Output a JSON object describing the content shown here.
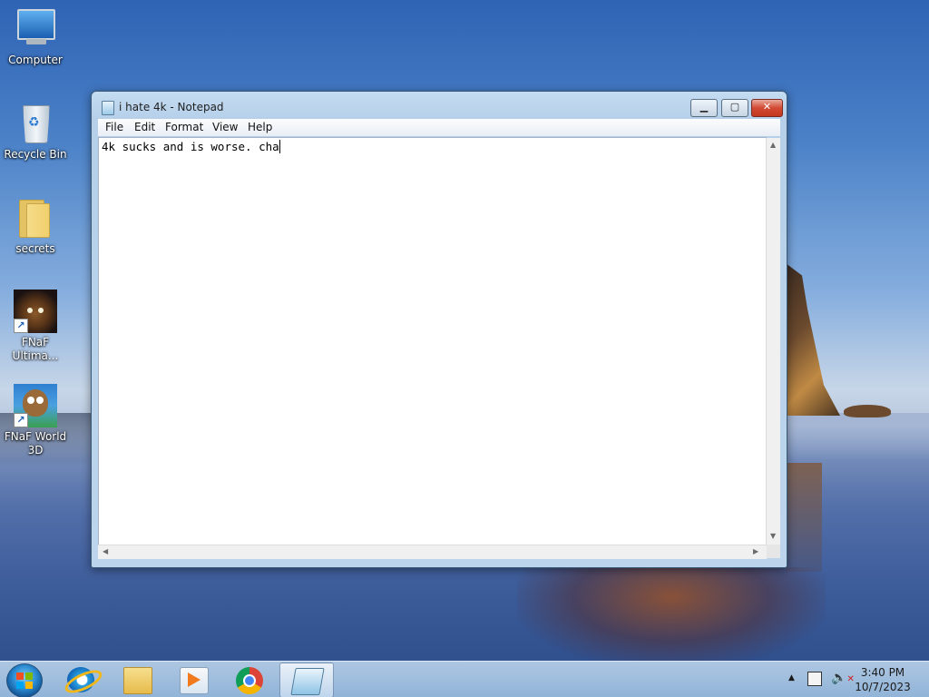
{
  "desktop": {
    "icons": [
      {
        "label": "Computer",
        "icon": "computer-icon"
      },
      {
        "label": "Recycle Bin",
        "icon": "recycle-bin-icon"
      },
      {
        "label": "secrets",
        "icon": "folder-icon"
      },
      {
        "label": "FNaF Ultima...",
        "label_line1": "FNaF",
        "label_line2": "Ultima...",
        "icon": "fnaf-game-icon"
      },
      {
        "label": "FNaF World 3D",
        "label_line1": "FNaF World",
        "label_line2": "3D",
        "icon": "fnaf-world-game-icon"
      }
    ]
  },
  "window": {
    "title": "i hate 4k - Notepad",
    "controls": {
      "minimize": "▁",
      "maximize": "▢",
      "close": "✕"
    },
    "menu": [
      "File",
      "Edit",
      "Format",
      "View",
      "Help"
    ],
    "content": "4k sucks and is worse. cha"
  },
  "taskbar": {
    "pinned": [
      {
        "name": "Internet Explorer",
        "icon": "internet-explorer-icon"
      },
      {
        "name": "Windows Explorer",
        "icon": "file-explorer-icon"
      },
      {
        "name": "Windows Media Player",
        "icon": "media-player-icon"
      },
      {
        "name": "Google Chrome",
        "icon": "chrome-icon"
      },
      {
        "name": "Notepad",
        "icon": "notepad-icon",
        "active": true
      }
    ],
    "tray": {
      "time": "3:40 PM",
      "date": "10/7/2023",
      "show_hidden": "▲",
      "network_icon": "network-icon",
      "volume_icon": "volume-muted-icon"
    }
  },
  "colors": {
    "close_button": "#d24a34",
    "window_frame": "#bcd5ec",
    "taskbar": "#a8c6e4"
  }
}
